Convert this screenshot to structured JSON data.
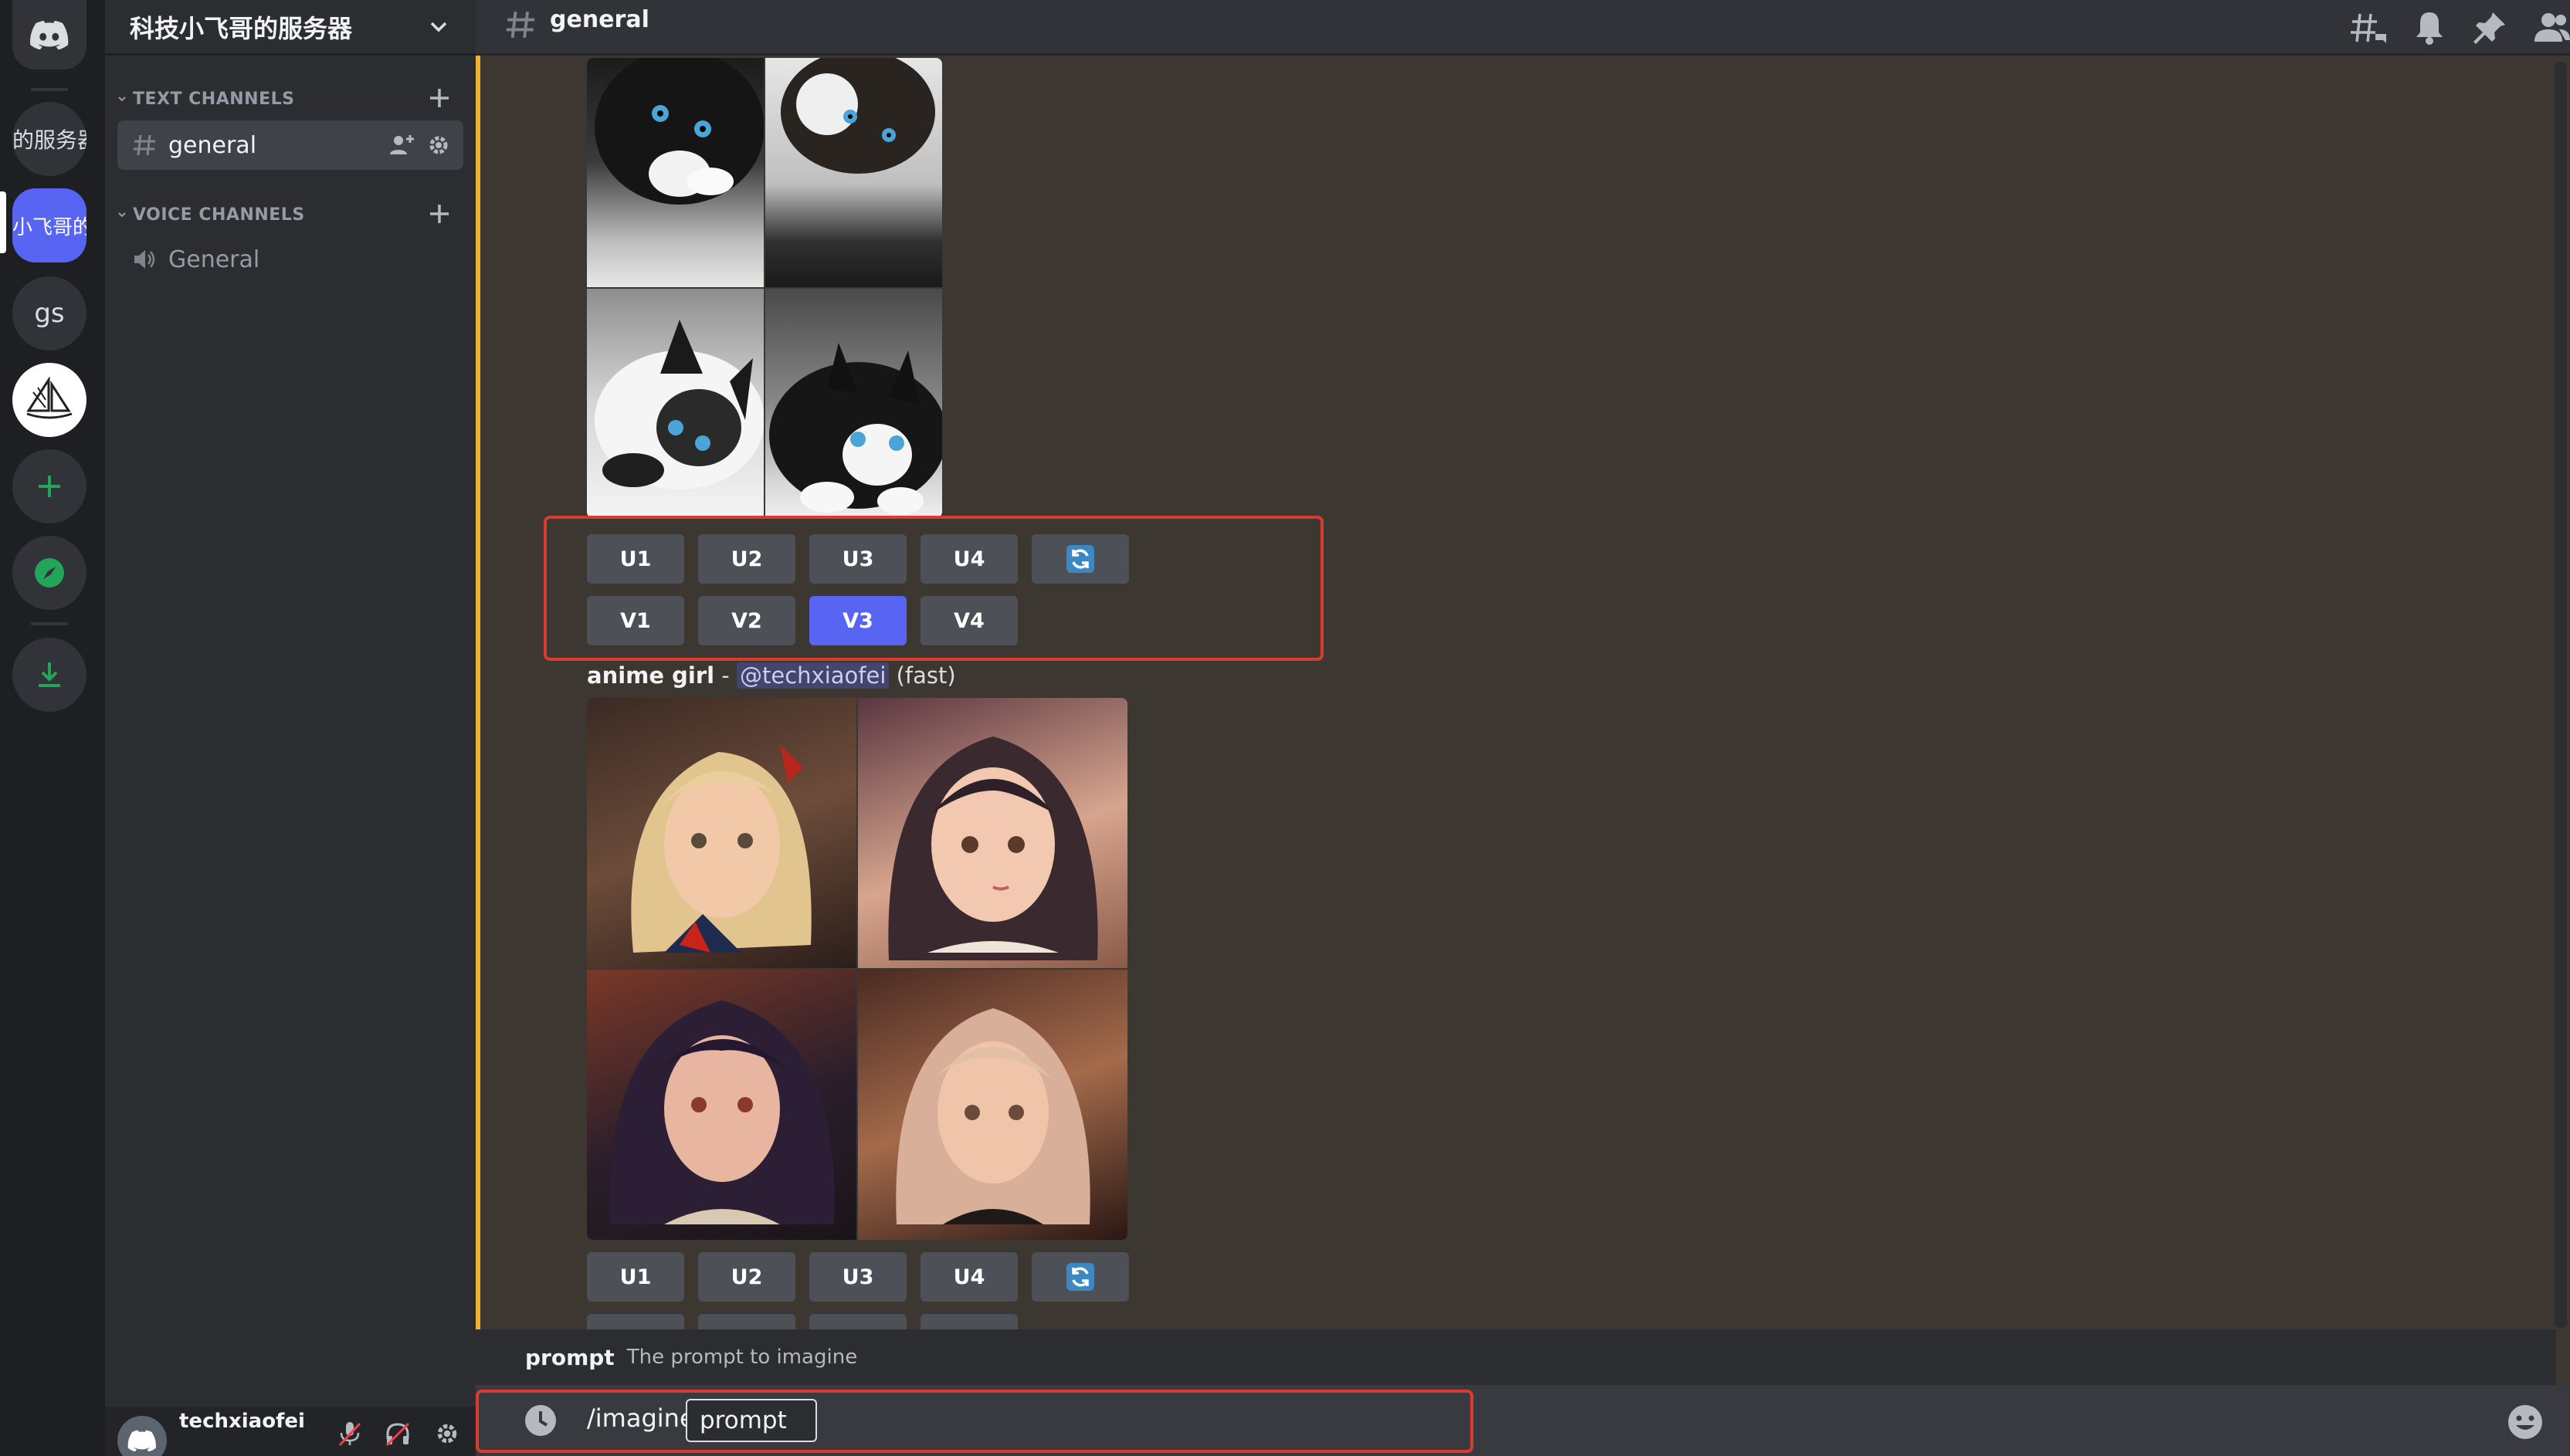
{
  "server_rail": {
    "items": [
      {
        "name": "discord-home",
        "text": ""
      },
      {
        "name": "server-1",
        "text": "的服务器"
      },
      {
        "name": "server-2",
        "text": "小飞哥的服务器"
      },
      {
        "name": "server-3",
        "text": "gs"
      },
      {
        "name": "server-4",
        "text": ""
      }
    ],
    "accent": "#5865f2"
  },
  "guild": {
    "name": "科技小飞哥的服务器",
    "categories": [
      {
        "label": "TEXT CHANNELS",
        "channels": [
          {
            "label": "general",
            "selected": true
          }
        ]
      },
      {
        "label": "VOICE CHANNELS",
        "channels": [
          {
            "label": "General",
            "selected": false
          }
        ]
      }
    ]
  },
  "user": {
    "name": "techxiaofei"
  },
  "channel": {
    "title": "general"
  },
  "messages": [
    {
      "subject": "cats-grid",
      "buttons_row1": [
        "U1",
        "U2",
        "U3",
        "U4"
      ],
      "buttons_row2": [
        "V1",
        "V2",
        "V3",
        "V4"
      ],
      "active_button": "V3"
    },
    {
      "prompt": "anime girl",
      "separator": " - ",
      "mention": "@techxiaofei",
      "mode": "(fast)",
      "buttons_row1": [
        "U1",
        "U2",
        "U3",
        "U4"
      ]
    }
  ],
  "command_option": {
    "name": "prompt",
    "description": "The prompt to imagine"
  },
  "composer": {
    "command": "/imagine",
    "param": "prompt"
  },
  "colors": {
    "highlight": "#da3b2c",
    "mention_bar": "#f0b232",
    "online_green": "#23a559"
  }
}
